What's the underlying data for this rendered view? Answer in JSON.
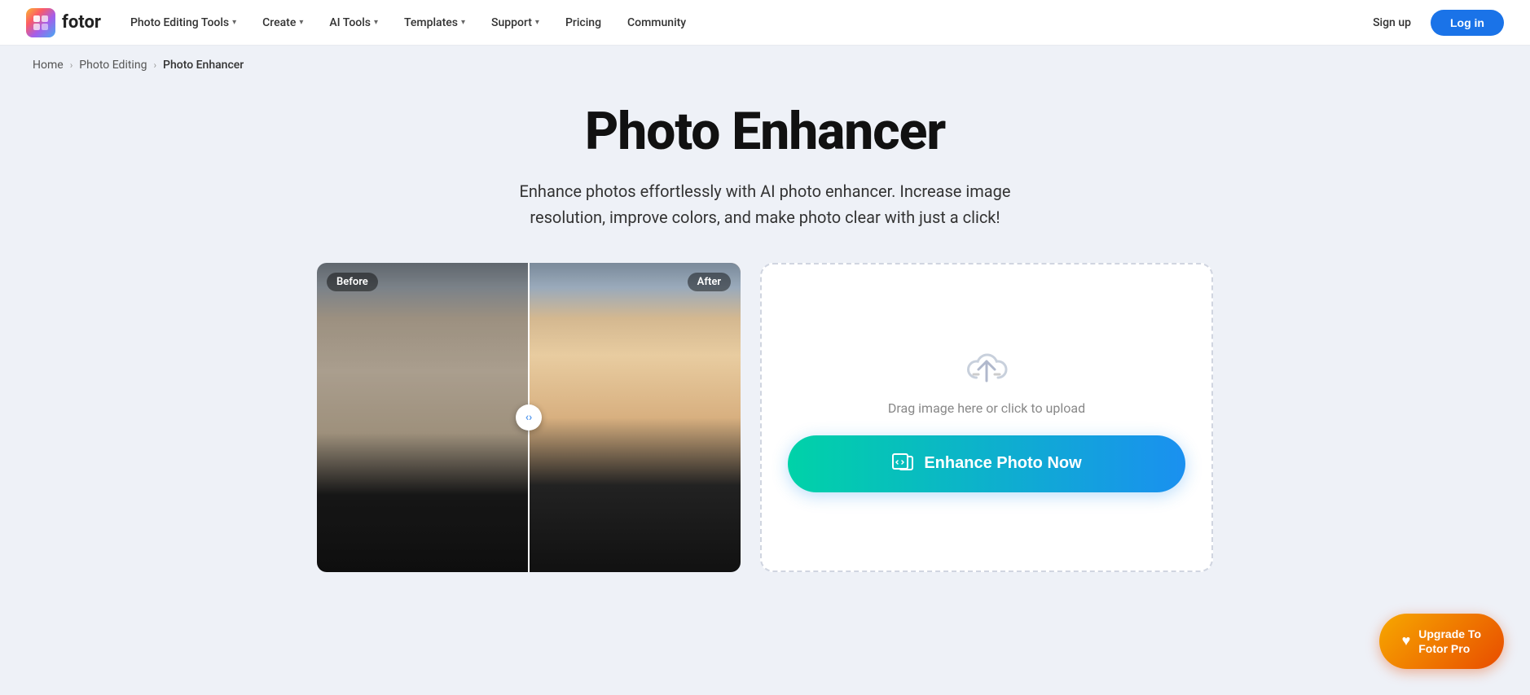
{
  "brand": {
    "name": "fotor",
    "logo_alt": "Fotor logo"
  },
  "nav": {
    "items": [
      {
        "id": "photo-editing-tools",
        "label": "Photo Editing Tools",
        "has_dropdown": true
      },
      {
        "id": "create",
        "label": "Create",
        "has_dropdown": true
      },
      {
        "id": "ai-tools",
        "label": "AI Tools",
        "has_dropdown": true
      },
      {
        "id": "templates",
        "label": "Templates",
        "has_dropdown": true
      },
      {
        "id": "support",
        "label": "Support",
        "has_dropdown": true
      },
      {
        "id": "pricing",
        "label": "Pricing",
        "has_dropdown": false
      },
      {
        "id": "community",
        "label": "Community",
        "has_dropdown": false
      }
    ],
    "signup_label": "Sign up",
    "login_label": "Log in"
  },
  "breadcrumb": {
    "home": "Home",
    "photo_editing": "Photo Editing",
    "current": "Photo Enhancer"
  },
  "hero": {
    "title": "Photo Enhancer",
    "subtitle": "Enhance photos effortlessly with AI photo enhancer. Increase image resolution, improve colors, and make photo clear with just a click!"
  },
  "before_after": {
    "before_label": "Before",
    "after_label": "After"
  },
  "upload": {
    "drag_label": "Drag image here or click to upload",
    "enhance_btn_label": "Enhance Photo Now"
  },
  "upgrade": {
    "line1": "Upgrade To",
    "line2": "Fotor Pro"
  }
}
